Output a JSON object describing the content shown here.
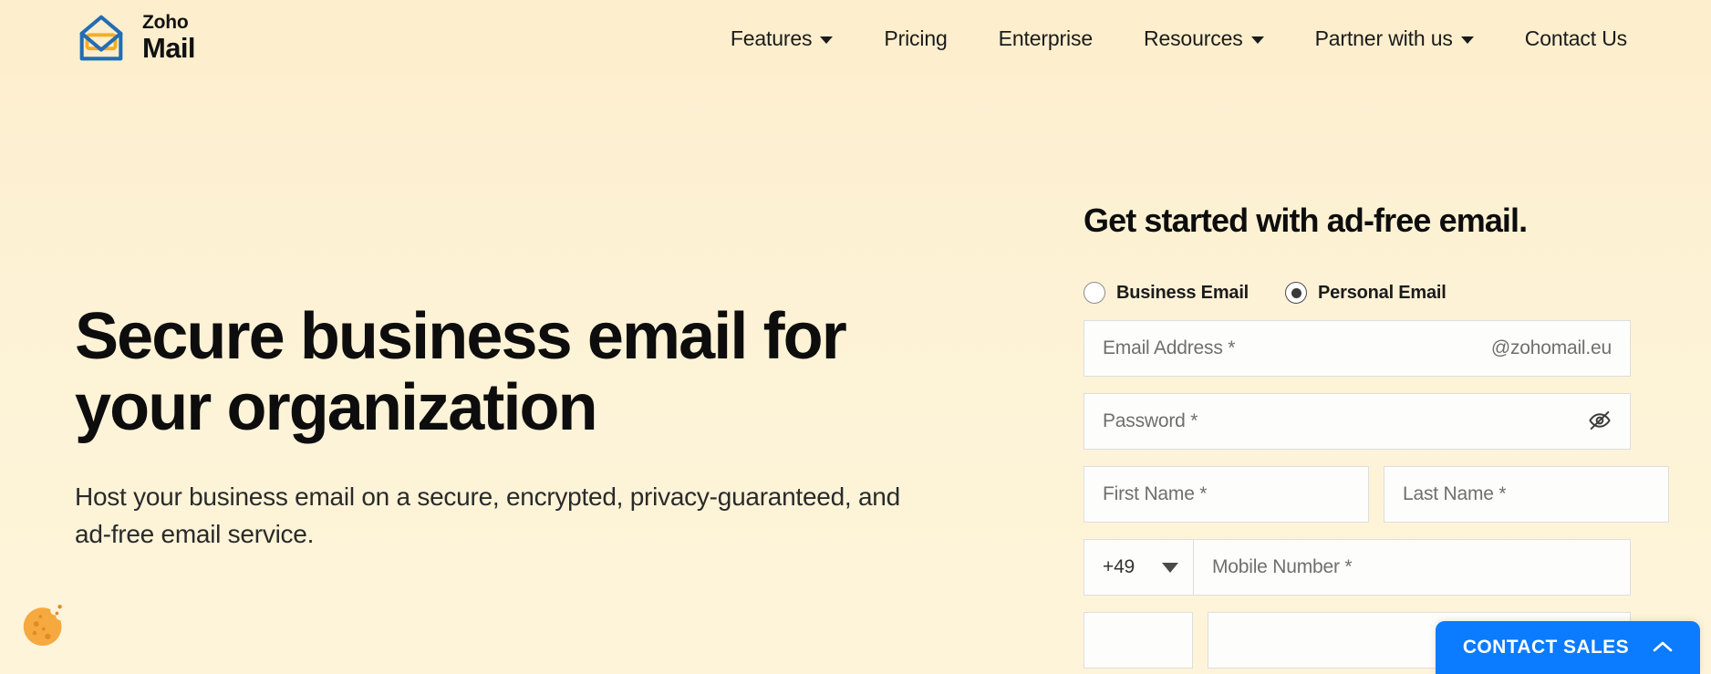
{
  "brand": {
    "zoho": "Zoho",
    "mail": "Mail",
    "logo_icon": "zoho-mail-envelope-logo",
    "logo_outline_color": "#226db4",
    "logo_flap_color": "#f5ad26"
  },
  "nav": {
    "items": [
      {
        "label": "Features",
        "has_dropdown": true
      },
      {
        "label": "Pricing",
        "has_dropdown": false
      },
      {
        "label": "Enterprise",
        "has_dropdown": false
      },
      {
        "label": "Resources",
        "has_dropdown": true
      },
      {
        "label": "Partner with us",
        "has_dropdown": true
      },
      {
        "label": "Contact Us",
        "has_dropdown": false
      }
    ]
  },
  "hero": {
    "title": "Secure business email for your organization",
    "subtitle": "Host your business email on a secure, encrypted, privacy-guaranteed, and ad-free email service."
  },
  "signup": {
    "title": "Get started with ad-free email.",
    "account_type": {
      "selected": "Personal Email",
      "options": [
        {
          "label": "Business Email",
          "checked": false
        },
        {
          "label": "Personal Email",
          "checked": true
        }
      ]
    },
    "email": {
      "placeholder": "Email Address *",
      "value": "",
      "domain_suffix": "@zohomail.eu"
    },
    "password": {
      "placeholder": "Password *",
      "value": "",
      "toggle_icon": "eye-off-icon"
    },
    "first_name": {
      "placeholder": "First Name *",
      "value": ""
    },
    "last_name": {
      "placeholder": "Last Name *",
      "value": ""
    },
    "country_code": {
      "value": "+49",
      "caret_icon": "caret-down-icon"
    },
    "mobile": {
      "placeholder": "Mobile Number *",
      "value": ""
    }
  },
  "cookie_widget": {
    "icon": "cookie-icon",
    "color": "#f6a93f"
  },
  "contact_sales": {
    "label": "CONTACT SALES",
    "icon": "chevron-up-icon",
    "color": "#0b7bff"
  }
}
